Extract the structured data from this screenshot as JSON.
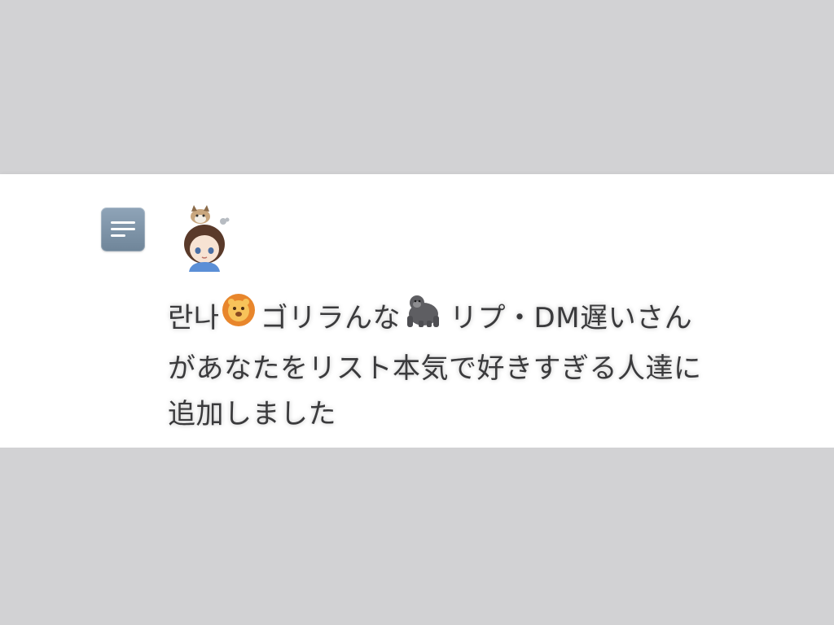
{
  "notification": {
    "icon": "list-icon",
    "avatar": "user-avatar",
    "user_name_part1": "란나",
    "emoji1": "lion-face-icon",
    "user_name_part2": "ゴリラんな",
    "emoji2": "gorilla-icon",
    "user_name_part3": "リプ・DM遅いさん",
    "line2": "があなたをリスト本気で好きすぎる人達に",
    "line3": "追加しました"
  },
  "colors": {
    "background": "#d2d2d4",
    "card": "#ffffff",
    "icon_bg": "#7d93a8",
    "text": "#3a3a3c"
  }
}
